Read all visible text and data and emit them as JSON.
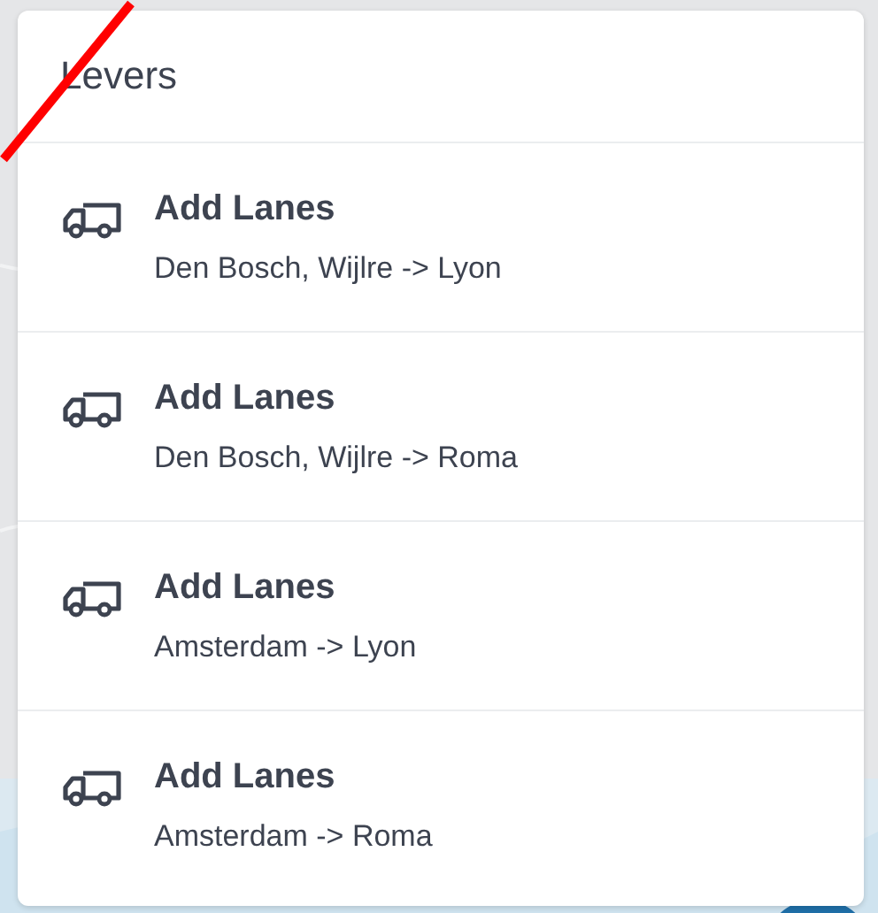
{
  "card": {
    "title": "Levers",
    "items": [
      {
        "title": "Add Lanes",
        "route": "Den Bosch, Wijlre -> Lyon"
      },
      {
        "title": "Add Lanes",
        "route": "Den Bosch, Wijlre -> Roma"
      },
      {
        "title": "Add Lanes",
        "route": "Amsterdam -> Lyon"
      },
      {
        "title": "Add Lanes",
        "route": "Amsterdam -> Roma"
      }
    ]
  }
}
